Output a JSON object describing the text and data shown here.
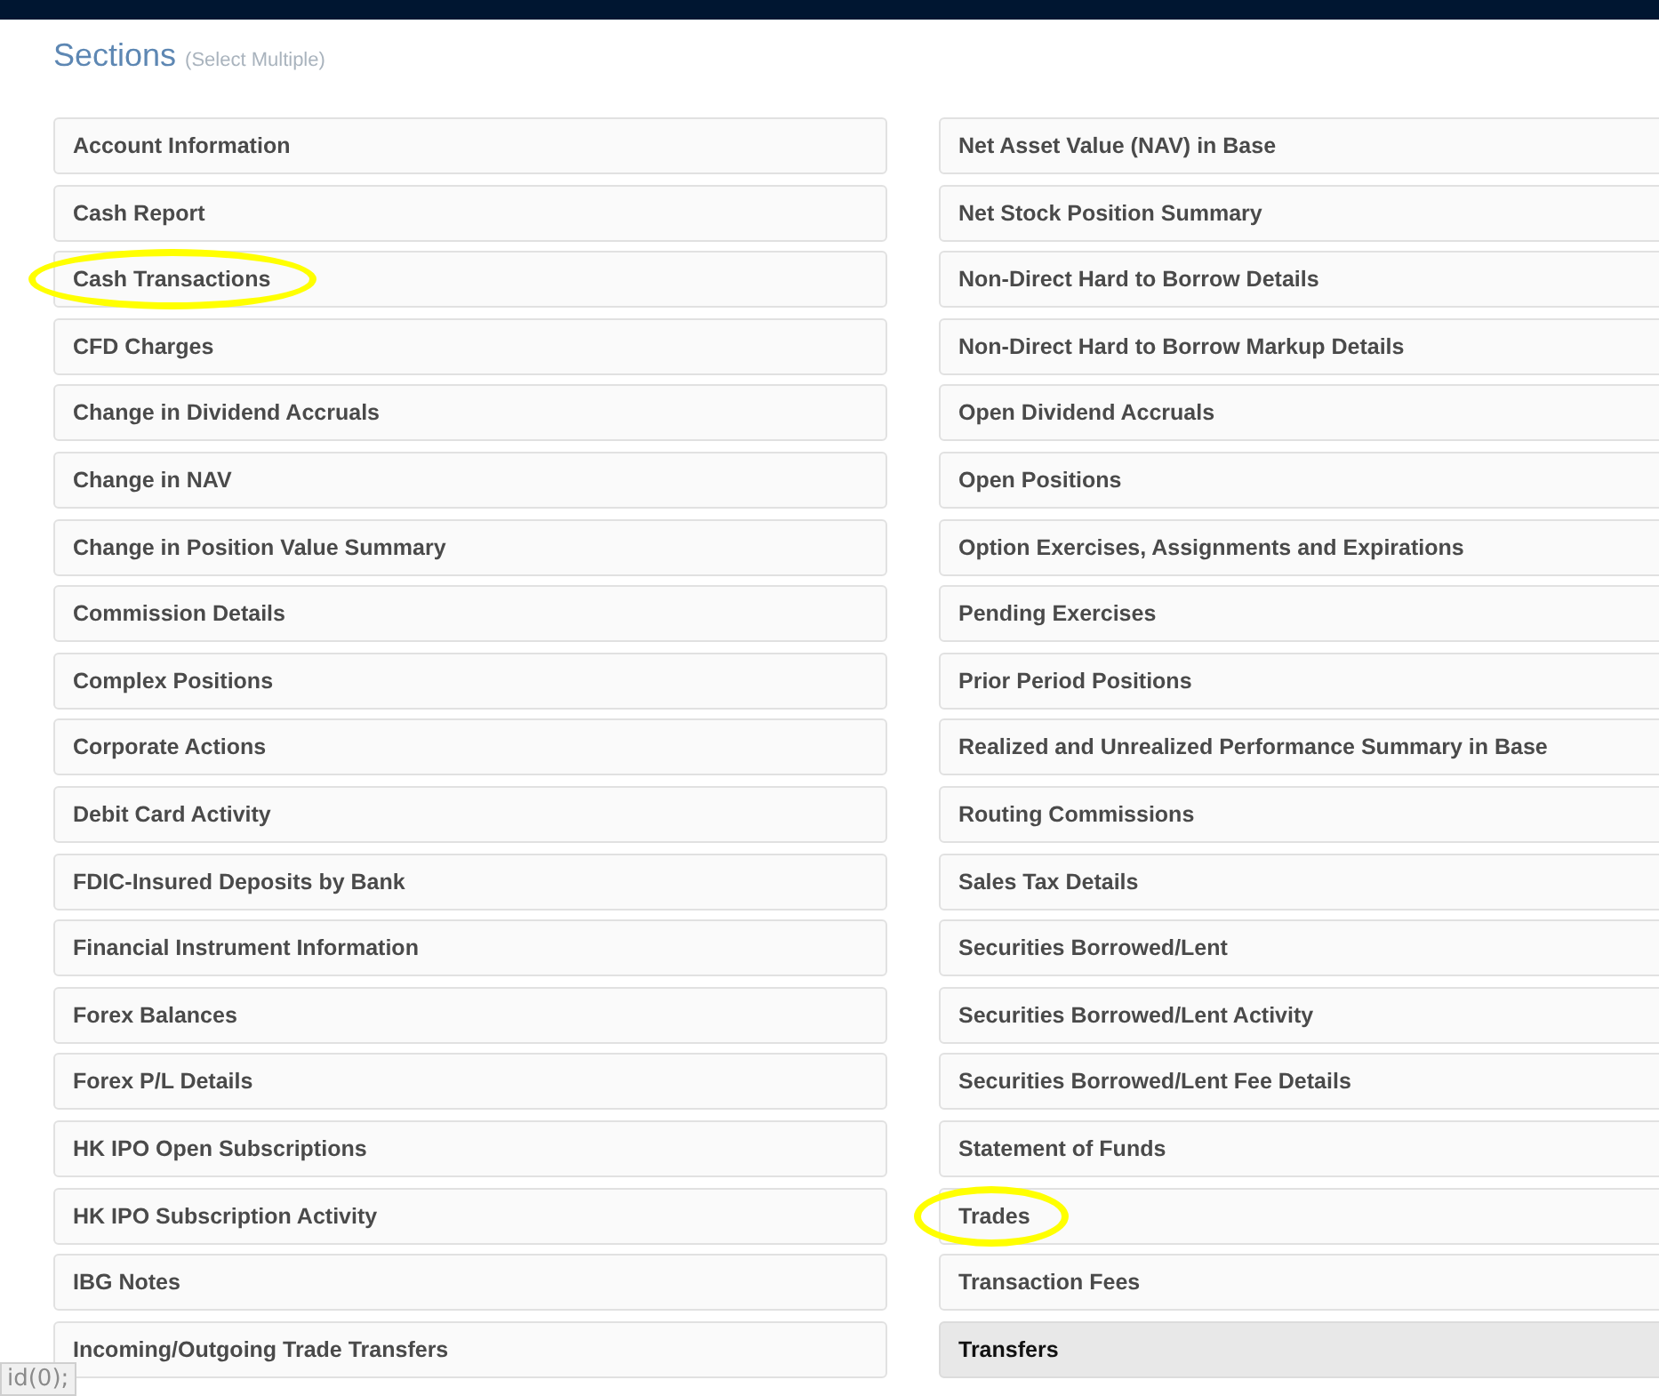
{
  "heading": {
    "title": "Sections",
    "hint": "(Select Multiple)"
  },
  "columns": [
    {
      "items": [
        {
          "label": "Account Information",
          "selected": false,
          "circled": false
        },
        {
          "label": "Cash Report",
          "selected": false,
          "circled": false
        },
        {
          "label": "Cash Transactions",
          "selected": false,
          "circled": true
        },
        {
          "label": "CFD Charges",
          "selected": false,
          "circled": false
        },
        {
          "label": "Change in Dividend Accruals",
          "selected": false,
          "circled": false
        },
        {
          "label": "Change in NAV",
          "selected": false,
          "circled": false
        },
        {
          "label": "Change in Position Value Summary",
          "selected": false,
          "circled": false
        },
        {
          "label": "Commission Details",
          "selected": false,
          "circled": false
        },
        {
          "label": "Complex Positions",
          "selected": false,
          "circled": false
        },
        {
          "label": "Corporate Actions",
          "selected": false,
          "circled": false
        },
        {
          "label": "Debit Card Activity",
          "selected": false,
          "circled": false
        },
        {
          "label": "FDIC-Insured Deposits by Bank",
          "selected": false,
          "circled": false
        },
        {
          "label": "Financial Instrument Information",
          "selected": false,
          "circled": false
        },
        {
          "label": "Forex Balances",
          "selected": false,
          "circled": false
        },
        {
          "label": "Forex P/L Details",
          "selected": false,
          "circled": false
        },
        {
          "label": "HK IPO Open Subscriptions",
          "selected": false,
          "circled": false
        },
        {
          "label": "HK IPO Subscription Activity",
          "selected": false,
          "circled": false
        },
        {
          "label": "IBG Notes",
          "selected": false,
          "circled": false
        },
        {
          "label": "Incoming/Outgoing Trade Transfers",
          "selected": false,
          "circled": false
        }
      ]
    },
    {
      "items": [
        {
          "label": "Net Asset Value (NAV) in Base",
          "selected": false,
          "circled": false
        },
        {
          "label": "Net Stock Position Summary",
          "selected": false,
          "circled": false
        },
        {
          "label": "Non-Direct Hard to Borrow Details",
          "selected": false,
          "circled": false
        },
        {
          "label": "Non-Direct Hard to Borrow Markup Details",
          "selected": false,
          "circled": false
        },
        {
          "label": "Open Dividend Accruals",
          "selected": false,
          "circled": false
        },
        {
          "label": "Open Positions",
          "selected": false,
          "circled": false
        },
        {
          "label": "Option Exercises, Assignments and Expirations",
          "selected": false,
          "circled": false
        },
        {
          "label": "Pending Exercises",
          "selected": false,
          "circled": false
        },
        {
          "label": "Prior Period Positions",
          "selected": false,
          "circled": false
        },
        {
          "label": "Realized and Unrealized Performance Summary in Base",
          "selected": false,
          "circled": false
        },
        {
          "label": "Routing Commissions",
          "selected": false,
          "circled": false
        },
        {
          "label": "Sales Tax Details",
          "selected": false,
          "circled": false
        },
        {
          "label": "Securities Borrowed/Lent",
          "selected": false,
          "circled": false
        },
        {
          "label": "Securities Borrowed/Lent Activity",
          "selected": false,
          "circled": false
        },
        {
          "label": "Securities Borrowed/Lent Fee Details",
          "selected": false,
          "circled": false
        },
        {
          "label": "Statement of Funds",
          "selected": false,
          "circled": false
        },
        {
          "label": "Trades",
          "selected": false,
          "circled": true
        },
        {
          "label": "Transaction Fees",
          "selected": false,
          "circled": false
        },
        {
          "label": "Transfers",
          "selected": true,
          "circled": false
        }
      ]
    }
  ],
  "status_bar": {
    "text": "id(0);"
  }
}
